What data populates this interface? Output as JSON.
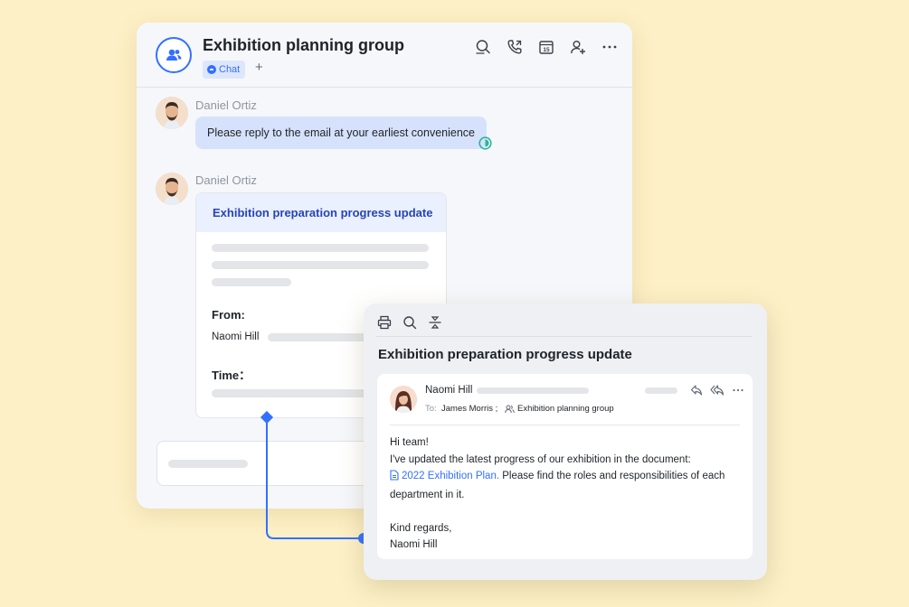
{
  "chat": {
    "title": "Exhibition planning group",
    "tab_label": "Chat",
    "add_tab": "+",
    "header_icons": [
      "search-icon",
      "call-icon",
      "calendar-icon",
      "add-member-icon",
      "more-icon"
    ],
    "calendar_day": "15",
    "messages": [
      {
        "sender": "Daniel Ortiz",
        "text": "Please reply to the email at your earliest convenience"
      },
      {
        "sender": "Daniel Ortiz"
      }
    ],
    "card": {
      "title": "Exhibition preparation progress update",
      "from_label": "From:",
      "from_value": "Naomi Hill",
      "time_label": "Time："
    }
  },
  "mail": {
    "toolbar_icons": [
      "print-icon",
      "search-icon",
      "strikethrough-icon"
    ],
    "subject": "Exhibition preparation progress update",
    "from": "Naomi Hill",
    "to_label": "To:",
    "to": "James Morris ;",
    "group": "Exhibition planning group",
    "action_icons": [
      "reply-icon",
      "reply-all-icon",
      "more-icon"
    ],
    "body": {
      "greeting": "Hi team!",
      "line1": "I've updated the latest progress of our exhibition in the document:",
      "doc_link": "2022 Exhibition Plan.",
      "line2_rest": " Please find the roles and responsibilities of each",
      "line3": "department in it.",
      "closing": "Kind regards,",
      "signature": "Naomi Hill"
    }
  },
  "colors": {
    "background": "#fdf0c6",
    "accent": "#3370ff",
    "read_status": "#2bb59a"
  }
}
